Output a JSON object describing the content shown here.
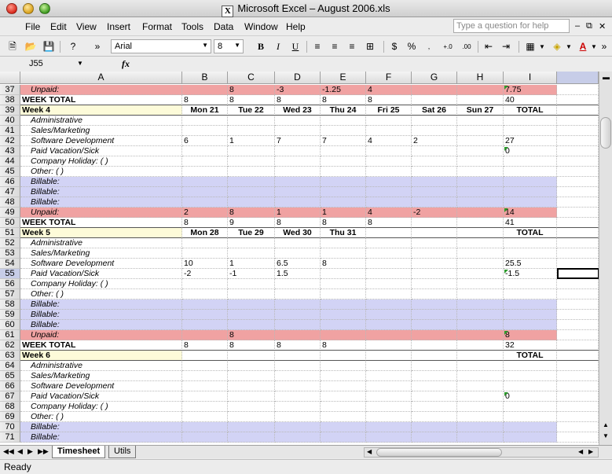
{
  "window": {
    "title": "Microsoft Excel – August 2006.xls"
  },
  "menu": [
    "File",
    "Edit",
    "View",
    "Insert",
    "Format",
    "Tools",
    "Data",
    "Window",
    "Help"
  ],
  "help_placeholder": "Type a question for help",
  "toolbar": {
    "font": "Arial",
    "size": "8"
  },
  "name_box": "J55",
  "fx_label": "fx",
  "columns": [
    "A",
    "B",
    "C",
    "D",
    "E",
    "F",
    "G",
    "H",
    "I"
  ],
  "rows": [
    {
      "n": "37",
      "type": "unpaid",
      "cells": [
        "Unpaid:",
        "",
        "8",
        "-3",
        "-1.25",
        "4",
        "",
        "",
        "7.75"
      ],
      "mark": true
    },
    {
      "n": "38",
      "type": "total",
      "cells": [
        "WEEK TOTAL",
        "8",
        "8",
        "8",
        "8",
        "8",
        "",
        "",
        "40"
      ]
    },
    {
      "n": "39",
      "type": "weekhdr",
      "cells": [
        "Week 4",
        "Mon 21",
        "Tue 22",
        "Wed 23",
        "Thu 24",
        "Fri 25",
        "Sat 26",
        "Sun 27",
        "TOTAL"
      ]
    },
    {
      "n": "40",
      "type": "item",
      "cells": [
        "Administrative",
        "",
        "",
        "",
        "",
        "",
        "",
        "",
        ""
      ]
    },
    {
      "n": "41",
      "type": "item",
      "cells": [
        "Sales/Marketing",
        "",
        "",
        "",
        "",
        "",
        "",
        "",
        ""
      ]
    },
    {
      "n": "42",
      "type": "item",
      "cells": [
        "Software Development",
        "6",
        "1",
        "7",
        "7",
        "4",
        "2",
        "",
        "27"
      ]
    },
    {
      "n": "43",
      "type": "item",
      "cells": [
        "Paid Vacation/Sick",
        "",
        "",
        "",
        "",
        "",
        "",
        "",
        "0"
      ],
      "mark": true
    },
    {
      "n": "44",
      "type": "item",
      "cells": [
        "Company Holiday: (                    )",
        "",
        "",
        "",
        "",
        "",
        "",
        "",
        ""
      ]
    },
    {
      "n": "45",
      "type": "item",
      "cells": [
        "Other: (                    )",
        "",
        "",
        "",
        "",
        "",
        "",
        "",
        ""
      ]
    },
    {
      "n": "46",
      "type": "billable",
      "cells": [
        "Billable:",
        "",
        "",
        "",
        "",
        "",
        "",
        "",
        ""
      ]
    },
    {
      "n": "47",
      "type": "billable",
      "cells": [
        "Billable:",
        "",
        "",
        "",
        "",
        "",
        "",
        "",
        ""
      ]
    },
    {
      "n": "48",
      "type": "billable",
      "cells": [
        "Billable:",
        "",
        "",
        "",
        "",
        "",
        "",
        "",
        ""
      ]
    },
    {
      "n": "49",
      "type": "unpaid",
      "cells": [
        "Unpaid:",
        "2",
        "8",
        "1",
        "1",
        "4",
        "-2",
        "",
        "14"
      ],
      "mark": true
    },
    {
      "n": "50",
      "type": "total",
      "cells": [
        "WEEK TOTAL",
        "8",
        "9",
        "8",
        "8",
        "8",
        "",
        "",
        "41"
      ]
    },
    {
      "n": "51",
      "type": "weekhdr",
      "cells": [
        "Week 5",
        "Mon 28",
        "Tue 29",
        "Wed 30",
        "Thu 31",
        "",
        "",
        "",
        "TOTAL"
      ]
    },
    {
      "n": "52",
      "type": "item",
      "cells": [
        "Administrative",
        "",
        "",
        "",
        "",
        "",
        "",
        "",
        ""
      ]
    },
    {
      "n": "53",
      "type": "item",
      "cells": [
        "Sales/Marketing",
        "",
        "",
        "",
        "",
        "",
        "",
        "",
        ""
      ]
    },
    {
      "n": "54",
      "type": "item",
      "cells": [
        "Software Development",
        "10",
        "1",
        "6.5",
        "8",
        "",
        "",
        "",
        "25.5"
      ]
    },
    {
      "n": "55",
      "type": "item",
      "cells": [
        "Paid Vacation/Sick",
        "-2",
        "-1",
        "1.5",
        "",
        "",
        "",
        "",
        "-1.5"
      ],
      "mark": true
    },
    {
      "n": "56",
      "type": "item",
      "cells": [
        "Company Holiday: (                    )",
        "",
        "",
        "",
        "",
        "",
        "",
        "",
        ""
      ]
    },
    {
      "n": "57",
      "type": "item",
      "cells": [
        "Other: (                    )",
        "",
        "",
        "",
        "",
        "",
        "",
        "",
        ""
      ]
    },
    {
      "n": "58",
      "type": "billable",
      "cells": [
        "Billable:",
        "",
        "",
        "",
        "",
        "",
        "",
        "",
        ""
      ]
    },
    {
      "n": "59",
      "type": "billable",
      "cells": [
        "Billable:",
        "",
        "",
        "",
        "",
        "",
        "",
        "",
        ""
      ]
    },
    {
      "n": "60",
      "type": "billable",
      "cells": [
        "Billable:",
        "",
        "",
        "",
        "",
        "",
        "",
        "",
        ""
      ]
    },
    {
      "n": "61",
      "type": "unpaid",
      "cells": [
        "Unpaid:",
        "",
        "8",
        "",
        "",
        "",
        "",
        "",
        "8"
      ],
      "mark": true
    },
    {
      "n": "62",
      "type": "total",
      "cells": [
        "WEEK TOTAL",
        "8",
        "8",
        "8",
        "8",
        "",
        "",
        "",
        "32"
      ]
    },
    {
      "n": "63",
      "type": "weekhdr",
      "cells": [
        "Week 6",
        "",
        "",
        "",
        "",
        "",
        "",
        "",
        "TOTAL"
      ]
    },
    {
      "n": "64",
      "type": "item",
      "cells": [
        "Administrative",
        "",
        "",
        "",
        "",
        "",
        "",
        "",
        ""
      ]
    },
    {
      "n": "65",
      "type": "item",
      "cells": [
        "Sales/Marketing",
        "",
        "",
        "",
        "",
        "",
        "",
        "",
        ""
      ]
    },
    {
      "n": "66",
      "type": "item",
      "cells": [
        "Software Development",
        "",
        "",
        "",
        "",
        "",
        "",
        "",
        ""
      ]
    },
    {
      "n": "67",
      "type": "item",
      "cells": [
        "Paid Vacation/Sick",
        "",
        "",
        "",
        "",
        "",
        "",
        "",
        "0"
      ],
      "mark": true
    },
    {
      "n": "68",
      "type": "item",
      "cells": [
        "Company Holiday: (                    )",
        "",
        "",
        "",
        "",
        "",
        "",
        "",
        ""
      ]
    },
    {
      "n": "69",
      "type": "item",
      "cells": [
        "Other: (                    )",
        "",
        "",
        "",
        "",
        "",
        "",
        "",
        ""
      ]
    },
    {
      "n": "70",
      "type": "billable",
      "cells": [
        "Billable:",
        "",
        "",
        "",
        "",
        "",
        "",
        "",
        ""
      ]
    },
    {
      "n": "71",
      "type": "billable",
      "cells": [
        "Billable:",
        "",
        "",
        "",
        "",
        "",
        "",
        "",
        ""
      ]
    }
  ],
  "selected_row": "55",
  "sheet_tabs": [
    {
      "label": "Timesheet",
      "active": true
    },
    {
      "label": "Utils",
      "active": false
    }
  ],
  "status": "Ready",
  "colors": {
    "unpaid": "#f0a2a2",
    "billable": "#d2d3f5",
    "week_header": "#fdfbd9"
  }
}
